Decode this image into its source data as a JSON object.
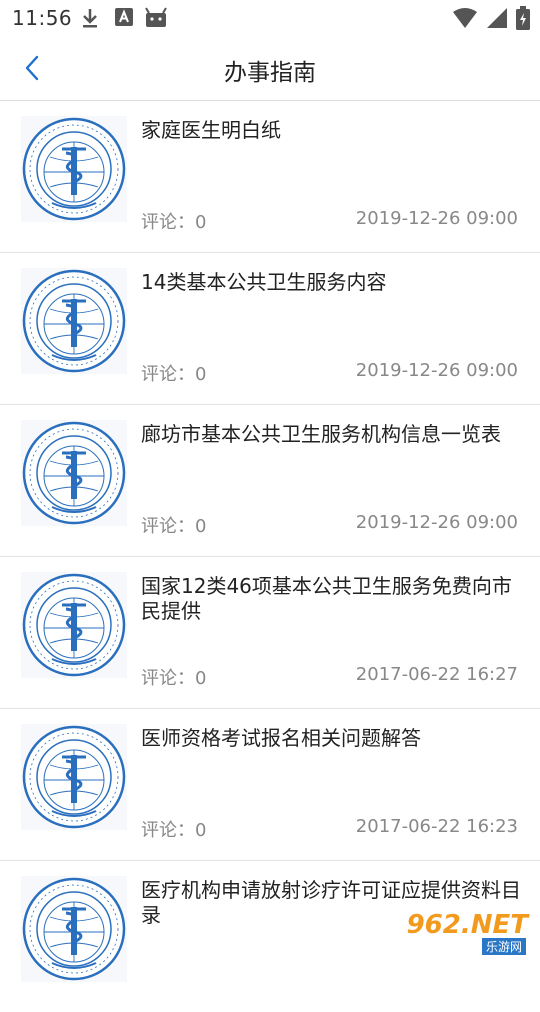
{
  "status_bar": {
    "time": "11:56"
  },
  "header": {
    "title": "办事指南",
    "back_icon": "chevron-left-icon"
  },
  "list": {
    "comment_label": "评论：",
    "items": [
      {
        "title": "家庭医生明白纸",
        "comments": "0",
        "date": "2019-12-26 09:00"
      },
      {
        "title": "14类基本公共卫生服务内容",
        "comments": "0",
        "date": "2019-12-26 09:00"
      },
      {
        "title": "廊坊市基本公共卫生服务机构信息一览表",
        "comments": "0",
        "date": "2019-12-26 09:00"
      },
      {
        "title": "国家12类46项基本公共卫生服务免费向市民提供",
        "comments": "0",
        "date": "2017-06-22 16:27"
      },
      {
        "title": "医师资格考试报名相关问题解答",
        "comments": "0",
        "date": "2017-06-22 16:23"
      },
      {
        "title": "医疗机构申请放射诊疗许可证应提供资料目录",
        "comments": "",
        "date": ""
      }
    ]
  },
  "watermark": {
    "text": "962.NET",
    "sub": "乐游网"
  },
  "colors": {
    "accent": "#1f6fd1",
    "emblem": "#2a6fbe",
    "text_secondary": "#888888"
  }
}
